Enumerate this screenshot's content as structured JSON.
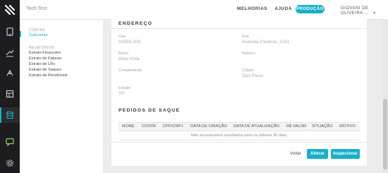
{
  "topbar": {
    "title": "Tech Test",
    "links": [
      "MELHORIAS",
      "AJUDA"
    ],
    "badge": "PRODUÇÃO",
    "user": "GIOVANI DE OLIVEIRA ..."
  },
  "sidebar": {
    "section1": "CONTAS",
    "items1": [
      "Subcontas"
    ],
    "section2": "RELATÓRIOS",
    "items2": [
      "Extrato Financeiro",
      "Extrato de Faturas",
      "Extrato de LRs",
      "Extrato de Saques",
      "Extrato de Recebíveis"
    ]
  },
  "address": {
    "title": "ENDEREÇO",
    "fields": [
      {
        "label": "Cep",
        "value": "03359-306"
      },
      {
        "label": "Rua",
        "value": "Avenida Paulista, 1041"
      },
      {
        "label": "Bairro",
        "value": "Bela Vista"
      },
      {
        "label": "Número",
        "value": ""
      },
      {
        "label": "Complemento",
        "value": ""
      },
      {
        "label": "Cidade",
        "value": "São Paulo"
      },
      {
        "label": "Estado",
        "value": "SP"
      }
    ]
  },
  "withdrawals": {
    "title": "PEDIDOS DE SAQUE",
    "columns": [
      "NOME",
      "CONTA",
      "CPF/CNPJ",
      "DATA DE CRIAÇÃO",
      "DATA DE ATUALIZAÇÃO",
      "R$ VALOR",
      "SITUAÇÃO",
      "MOTIVO"
    ],
    "empty_message": "Não encontramos resultados para os últimos 30 dias."
  },
  "actions": {
    "back": "Voltar",
    "edit": "Alterar",
    "inspect": "Inspecionar"
  },
  "colors": {
    "accent": "#18b0c8",
    "sidebar_dark": "#1d1d1f"
  }
}
